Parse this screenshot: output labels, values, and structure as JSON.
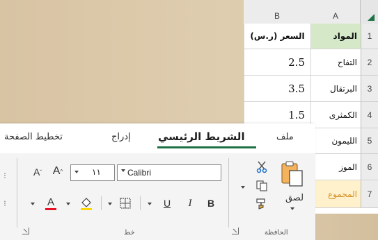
{
  "sheet": {
    "col_headers": [
      "A",
      "B"
    ],
    "rows": [
      {
        "n": "1",
        "a": "المواد",
        "b": "السعر (ر.س)"
      },
      {
        "n": "2",
        "a": "التفاح",
        "b": "2.5"
      },
      {
        "n": "3",
        "a": "البرتقال",
        "b": "3.5"
      },
      {
        "n": "4",
        "a": "الكمثرى",
        "b": "1.5"
      },
      {
        "n": "5",
        "a": "الليمون",
        "b": ""
      },
      {
        "n": "6",
        "a": "الموز",
        "b": ""
      },
      {
        "n": "7",
        "a": "المجموع",
        "b": ""
      }
    ]
  },
  "ribbon": {
    "tabs": [
      "ملف",
      "الشريط الرئيسي",
      "إدراج",
      "تخطيط الصفحة"
    ],
    "active_tab": "الشريط الرئيسي",
    "clipboard": {
      "group_label": "الحافظة",
      "paste_label": "لصق"
    },
    "font": {
      "group_label": "خط",
      "font_name": "Calibri",
      "font_size": "١١",
      "bold": "B",
      "italic": "I",
      "underline": "U",
      "font_color_glyph": "A",
      "grow": "A",
      "shrink": "A"
    },
    "colors": {
      "accent": "#1e7145",
      "font_color": "#e81123",
      "highlight": "#ffd800"
    }
  }
}
